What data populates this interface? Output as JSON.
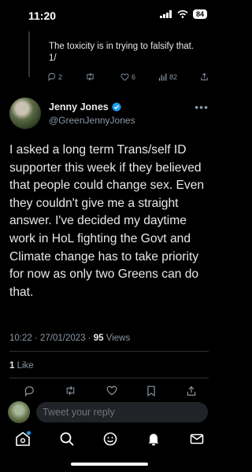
{
  "status_bar": {
    "time": "11:20",
    "battery": "84"
  },
  "previous_tweet": {
    "text": "The toxicity is in trying to falsify that. 1/",
    "replies": "2",
    "retweets": "",
    "likes": "6",
    "views": "82"
  },
  "tweet": {
    "author_name": "Jenny Jones",
    "author_handle": "@GreenJennyJones",
    "text": "I asked a long term Trans/self ID supporter this week if they believed that people could change sex. Even they couldn't give me a straight answer. I've decided my daytime work in HoL fighting the Govt and Climate change has to take priority for now as only two Greens can do that.",
    "timestamp": "10:22 · 27/01/2023 · ",
    "views_count": "95",
    "views_label": " Views",
    "likes_count": "1",
    "likes_label": " Like"
  },
  "reply": {
    "placeholder": "Tweet your reply"
  },
  "colors": {
    "background": "#000000",
    "accent": "#1d9bf0",
    "muted": "#8b98a5"
  }
}
